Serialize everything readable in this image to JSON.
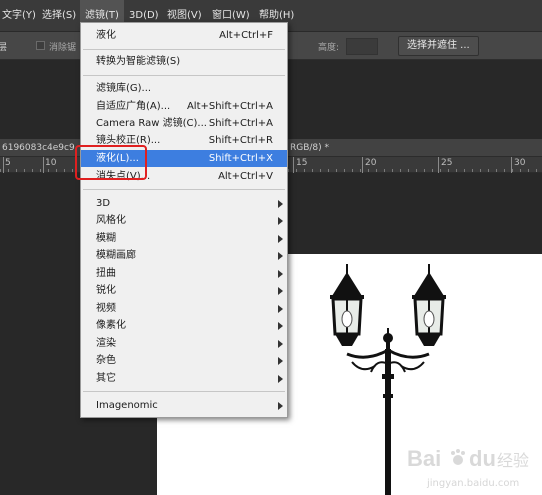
{
  "menubar": {
    "items": [
      "文字(Y)",
      "选择(S)",
      "滤镜(T)",
      "3D(D)",
      "视图(V)",
      "窗口(W)",
      "帮助(H)"
    ]
  },
  "options_bar": {
    "left_fragment": "层",
    "feather_label": "消除锯",
    "height_label": "高度:",
    "select_mask_button": "选择并遮住 ..."
  },
  "document": {
    "tab_name": "6196083c4e9c9",
    "tab_mode": "RGB/8) *",
    "ruler_numbers": [
      "5",
      "10",
      "15",
      "20",
      "25",
      "30"
    ]
  },
  "filter_menu": {
    "items": [
      {
        "label": "液化",
        "shortcut": "Alt+Ctrl+F"
      },
      {
        "label": "转换为智能滤镜(S)",
        "shortcut": ""
      },
      {
        "label": "滤镜库(G)...",
        "shortcut": ""
      },
      {
        "label": "自适应广角(A)...",
        "shortcut": "Alt+Shift+Ctrl+A"
      },
      {
        "label": "Camera Raw 滤镜(C)...",
        "shortcut": "Shift+Ctrl+A"
      },
      {
        "label": "镜头校正(R)...",
        "shortcut": "Shift+Ctrl+R"
      },
      {
        "label": "液化(L)...",
        "shortcut": "Shift+Ctrl+X"
      },
      {
        "label": "消失点(V)...",
        "shortcut": "Alt+Ctrl+V"
      },
      {
        "label": "3D",
        "shortcut": ""
      },
      {
        "label": "风格化",
        "shortcut": ""
      },
      {
        "label": "模糊",
        "shortcut": ""
      },
      {
        "label": "模糊画廊",
        "shortcut": ""
      },
      {
        "label": "扭曲",
        "shortcut": ""
      },
      {
        "label": "锐化",
        "shortcut": ""
      },
      {
        "label": "视频",
        "shortcut": ""
      },
      {
        "label": "像素化",
        "shortcut": ""
      },
      {
        "label": "渲染",
        "shortcut": ""
      },
      {
        "label": "杂色",
        "shortcut": ""
      },
      {
        "label": "其它",
        "shortcut": ""
      },
      {
        "label": "Imagenomic",
        "shortcut": ""
      }
    ],
    "highlighted_index": 6
  },
  "watermark": {
    "brand": "Bai",
    "brand2": "du",
    "cn": "经验",
    "url": "jingyan.baidu.com"
  },
  "colors": {
    "menu_highlight": "#3d7ee0",
    "annotation_red": "#e02020",
    "menubar_bg": "#3a3a3a"
  }
}
